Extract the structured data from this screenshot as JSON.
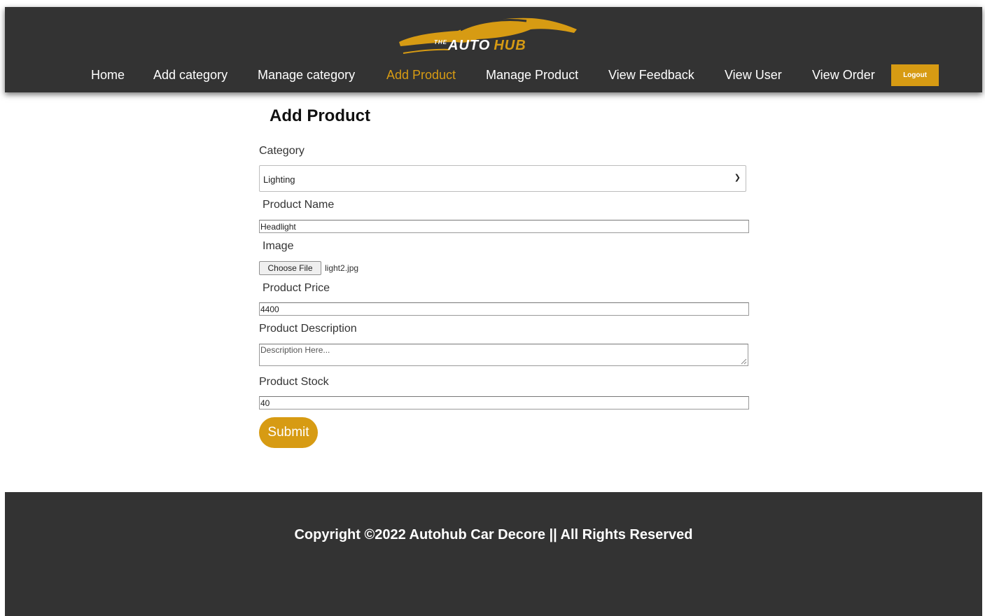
{
  "brand": {
    "the": "THE",
    "auto": "AUTO",
    "hub": "HUB"
  },
  "nav": {
    "home": "Home",
    "add_category": "Add category",
    "manage_category": "Manage category",
    "add_product": "Add Product",
    "manage_product": "Manage Product",
    "view_feedback": "View Feedback",
    "view_user": "View User",
    "view_order": "View Order",
    "logout": "Logout"
  },
  "form": {
    "title": "Add Product",
    "category_label": "Category",
    "category_value": "Lighting",
    "product_name_label": "Product Name",
    "product_name_value": "Headlight",
    "image_label": "Image",
    "file_button": "Choose File",
    "file_name": "light2.jpg",
    "price_label": "Product Price",
    "price_value": "4400",
    "description_label": "Product Description",
    "description_placeholder": "Description Here...",
    "stock_label": "Product Stock",
    "stock_value": "40",
    "submit": "Submit"
  },
  "footer": {
    "copyright": "Copyright ©2022 Autohub Car Decore || All Rights Reserved"
  },
  "colors": {
    "header_bg": "#333333",
    "accent": "#d79b13",
    "footer_bg": "#333333"
  }
}
